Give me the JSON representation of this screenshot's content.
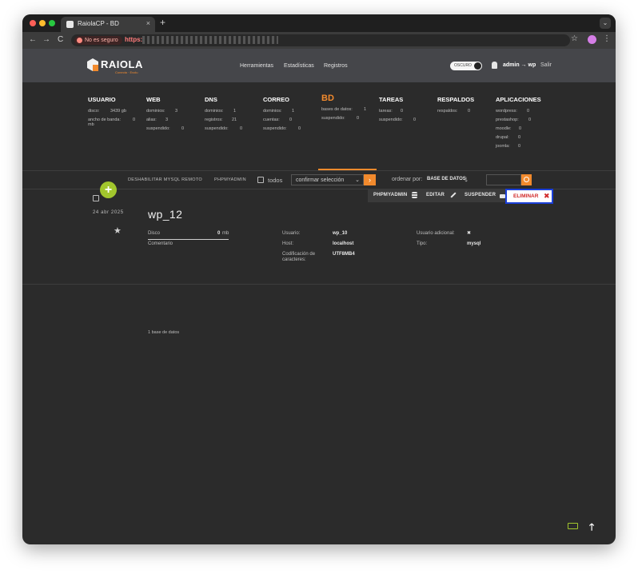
{
  "browser": {
    "tab_title": "RaiolaCP - BD",
    "tab_close": "×",
    "new_tab": "+",
    "security_label": "No es seguro",
    "url_scheme": "https:/",
    "nav_back": "←",
    "nav_forward": "→",
    "nav_reload": "C",
    "bookmark": "☆",
    "menu": "⋮",
    "tab_menu": "⌄"
  },
  "header": {
    "logo_text": "RAIOLA",
    "logo_sub": "Conecta · Evolu",
    "nav": [
      "Herramientas",
      "Estadísticas",
      "Registros"
    ],
    "theme_label": "OSCURO",
    "user": "admin → wp",
    "logout": "Salir"
  },
  "stats": [
    {
      "title": "USUARIO",
      "rows": [
        [
          "disco:",
          "3439 gb"
        ],
        [
          "ancho de banda:",
          "0"
        ],
        [
          "mb",
          ""
        ]
      ]
    },
    {
      "title": "WEB",
      "rows": [
        [
          "dominios:",
          "3"
        ],
        [
          "alias:",
          "3"
        ],
        [
          "suspendido:",
          "0"
        ]
      ]
    },
    {
      "title": "DNS",
      "rows": [
        [
          "dominios:",
          "1"
        ],
        [
          "registros:",
          "21"
        ],
        [
          "suspendido:",
          "0"
        ]
      ]
    },
    {
      "title": "CORREO",
      "rows": [
        [
          "dominios:",
          "1"
        ],
        [
          "cuentas:",
          "0"
        ],
        [
          "suspendido:",
          "0"
        ]
      ]
    },
    {
      "title": "BD",
      "rows": [
        [
          "bases de datos:",
          "1"
        ],
        [
          "suspendido:",
          "0"
        ]
      ]
    },
    {
      "title": "TAREAS",
      "rows": [
        [
          "tareas:",
          "0"
        ],
        [
          "suspendido:",
          "0"
        ]
      ]
    },
    {
      "title": "RESPALDOS",
      "rows": [
        [
          "respaldos:",
          "0"
        ]
      ]
    },
    {
      "title": "APLICACIONES",
      "rows": [
        [
          "wordpress:",
          "0"
        ],
        [
          "prestashop:",
          "0"
        ],
        [
          "moodle:",
          "0"
        ],
        [
          "drupal:",
          "0"
        ],
        [
          "joomla:",
          "0"
        ]
      ]
    }
  ],
  "filterbar": {
    "disable_remote": "DESHABILITAR MYSQL REMOTO",
    "phpmyadmin": "PHPMYADMIN",
    "all_label": "todos",
    "select_value": "confirmar selección",
    "order_label": "ordenar por:",
    "order_value": "BASE DE DATOS",
    "go": "›",
    "order_arrow": "🡓"
  },
  "add_button": "+",
  "actions": {
    "phpmyadmin": "PHPMYADMIN",
    "edit": "EDITAR",
    "suspend": "SUSPENDER",
    "delete": "ELIMINAR",
    "delete_x": "✖"
  },
  "record": {
    "date": "24 abr 2025",
    "name": "wp_12",
    "star": "★",
    "disk_label": "Disco",
    "disk_value": "0",
    "disk_unit": "mb",
    "comment_label": "Comentario",
    "user_label": "Usuario:",
    "user_value": "wp_10",
    "host_label": "Host:",
    "host_value": "localhost",
    "charset_label_1": "Codificación de",
    "charset_label_2": "caracteres:",
    "charset_value": "UTF8MB4",
    "extra_user_label": "Usuario adicional:",
    "extra_user_value": "✖",
    "type_label": "Tipo:",
    "type_value": "mysql"
  },
  "footer_count": "1 base de datos",
  "scroll_top": "🡑"
}
